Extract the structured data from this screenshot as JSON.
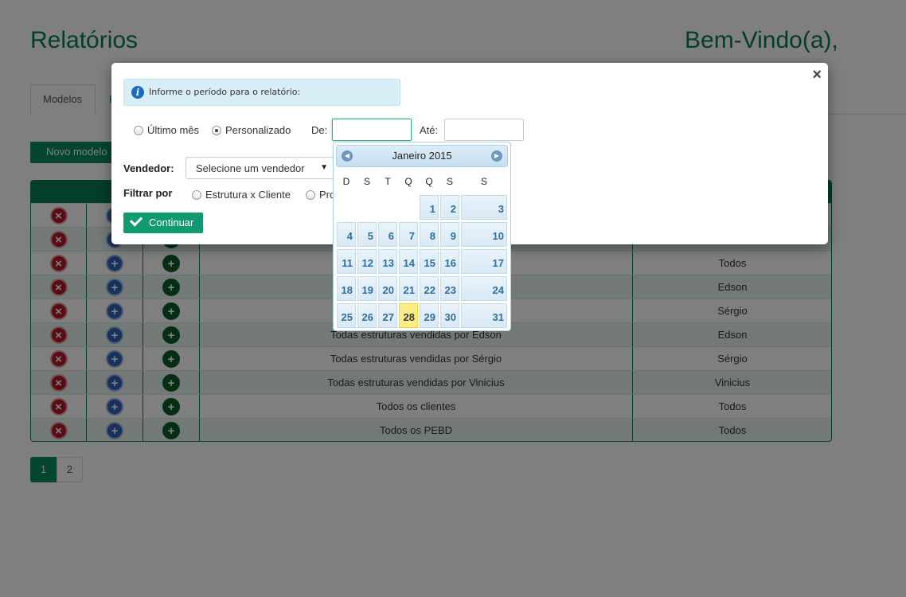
{
  "page": {
    "title": "Relatórios",
    "welcome": "Bem-Vindo(a),",
    "tabs": [
      "Modelos",
      "R"
    ],
    "new_button": "Novo modelo",
    "rows": [
      {
        "description": "",
        "seller": ""
      },
      {
        "description": "",
        "seller": ""
      },
      {
        "description": "",
        "seller": "Todos"
      },
      {
        "description": "T",
        "seller": "Edson"
      },
      {
        "description": "To",
        "seller": "Sérgio"
      },
      {
        "description": "Todas estruturas vendidas por Edson",
        "seller": "Edson"
      },
      {
        "description": "Todas estruturas vendidas por Sérgio",
        "seller": "Sérgio"
      },
      {
        "description": "Todas estruturas vendidas por Vinicius",
        "seller": "Vinicius"
      },
      {
        "description": "Todos os clientes",
        "seller": "Todos"
      },
      {
        "description": "Todos os PEBD",
        "seller": "Todos"
      }
    ],
    "pagination": [
      "1",
      "2"
    ]
  },
  "modal": {
    "info": "Informe o período para o relatório:",
    "info_icon": "i",
    "close": "×",
    "period_last_month": "Último mês",
    "period_custom": "Personalizado",
    "from_label": "De:",
    "to_label": "Até:",
    "from_value": "",
    "to_value": "",
    "seller_label": "Vendedor:",
    "seller_select": "Selecione um vendedor",
    "filter_label": "Filtrar por",
    "filter_option_1": "Estrutura x Cliente",
    "filter_option_2": "Pro",
    "continue_button": "Continuar"
  },
  "datepicker": {
    "month_year": "Janeiro 2015",
    "weekdays": [
      "D",
      "S",
      "T",
      "Q",
      "Q",
      "S",
      "S"
    ],
    "days": [
      "1",
      "2",
      "3",
      "4",
      "5",
      "6",
      "7",
      "8",
      "9",
      "10",
      "11",
      "12",
      "13",
      "14",
      "15",
      "16",
      "17",
      "18",
      "19",
      "20",
      "21",
      "22",
      "23",
      "24",
      "25",
      "26",
      "27",
      "28",
      "29",
      "30",
      "31"
    ],
    "today": "28"
  },
  "colors": {
    "brand_green": "#0a7a57",
    "button_green": "#119a72",
    "today_highlight": "#fbec88"
  }
}
